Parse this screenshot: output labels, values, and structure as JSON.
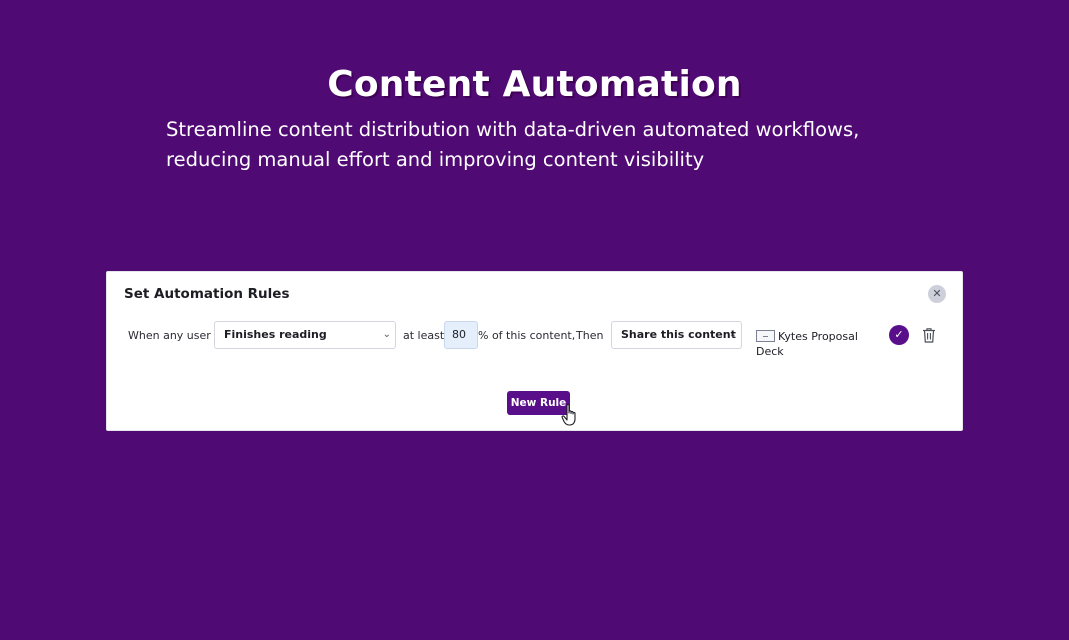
{
  "hero": {
    "title": "Content Automation",
    "subtitle": "Streamline content distribution with data-driven automated workflows, reducing manual effort and improving content visibility"
  },
  "card": {
    "title": "Set Automation Rules",
    "close_icon": "close-icon"
  },
  "rule": {
    "when_label": "When any user",
    "action_select": "Finishes reading",
    "at_least_label": "at least",
    "percent_value": "80",
    "percent_label": "% of this content,",
    "then_label": "Then",
    "result_select": "Share this content",
    "document_name": "Kytes Proposal Deck",
    "document_icon": "document-icon",
    "confirm_icon": "check-icon",
    "delete_icon": "trash-icon"
  },
  "footer": {
    "new_rule_label": "New Rule",
    "cursor_icon": "hand-pointer-icon"
  },
  "colors": {
    "background": "#500a73",
    "accent": "#5a0f8a",
    "card": "#ffffff"
  }
}
